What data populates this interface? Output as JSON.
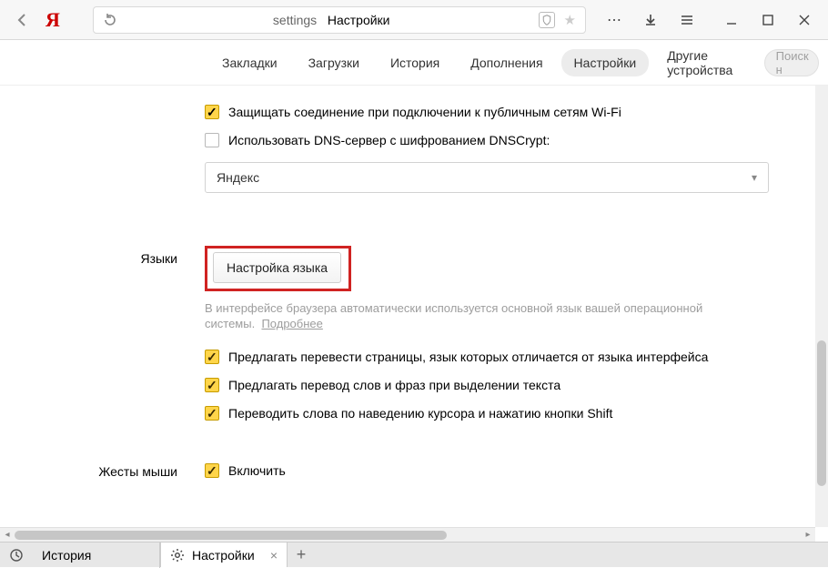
{
  "titlebar": {
    "brand_letter": "Я",
    "reload_icon": "reload",
    "page_url_left": "settings",
    "page_url_right": "Настройки"
  },
  "navtabs": [
    "Закладки",
    "Загрузки",
    "История",
    "Дополнения",
    "Настройки",
    "Другие устройства"
  ],
  "navtabs_active_index": 4,
  "search_placeholder": "Поиск н",
  "network": {
    "cb_protect": "Защищать соединение при подключении к публичным сетям Wi-Fi",
    "cb_dnscrypt": "Использовать DNS-сервер с шифрованием DNSCrypt:",
    "dns_value": "Яндекс"
  },
  "languages": {
    "section_label": "Языки",
    "btn_label": "Настройка языка",
    "helper_text": "В интерфейсе браузера автоматически используется основной язык вашей операционной системы.",
    "helper_link": "Подробнее",
    "cb_translate_pages": "Предлагать перевести страницы, язык которых отличается от языка интерфейса",
    "cb_translate_words": "Предлагать перевод слов и фраз при выделении текста",
    "cb_translate_hover": "Переводить слова по наведению курсора и нажатию кнопки Shift"
  },
  "mouse": {
    "section_label": "Жесты мыши",
    "cb_enable": "Включить"
  },
  "bottom_tabs": {
    "history_label": "История",
    "settings_label": "Настройки"
  }
}
